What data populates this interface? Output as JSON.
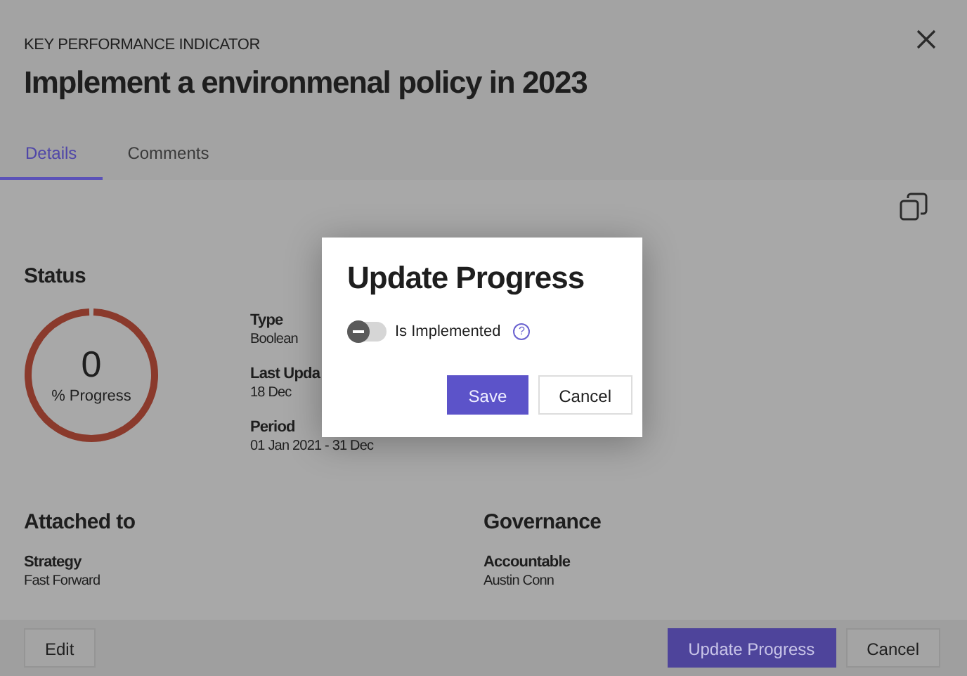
{
  "header": {
    "kicker": "KEY PERFORMANCE INDICATOR",
    "title": "Implement a environmenal policy in 2023"
  },
  "tabs": [
    {
      "label": "Details",
      "selected": true
    },
    {
      "label": "Comments",
      "selected": false
    }
  ],
  "status": {
    "heading": "Status",
    "value": "0",
    "caption": "% Progress"
  },
  "fields": [
    {
      "label": "Type",
      "value": "Boolean"
    },
    {
      "label": "Last Upda",
      "value": "18 Dec"
    },
    {
      "label": "Period",
      "value": "01 Jan 2021 - 31 Dec"
    }
  ],
  "sections": [
    {
      "heading": "Attached to",
      "label": "Strategy",
      "value": "Fast Forward"
    },
    {
      "heading": "Governance",
      "label": "Accountable",
      "value": "Austin Conn"
    }
  ],
  "footer": {
    "edit": "Edit",
    "primary": "Update Progress",
    "cancel": "Cancel"
  },
  "dialog": {
    "title": "Update Progress",
    "toggle": {
      "label": "Is Implemented",
      "on": false
    },
    "help": "?",
    "save": "Save",
    "cancel": "Cancel"
  }
}
